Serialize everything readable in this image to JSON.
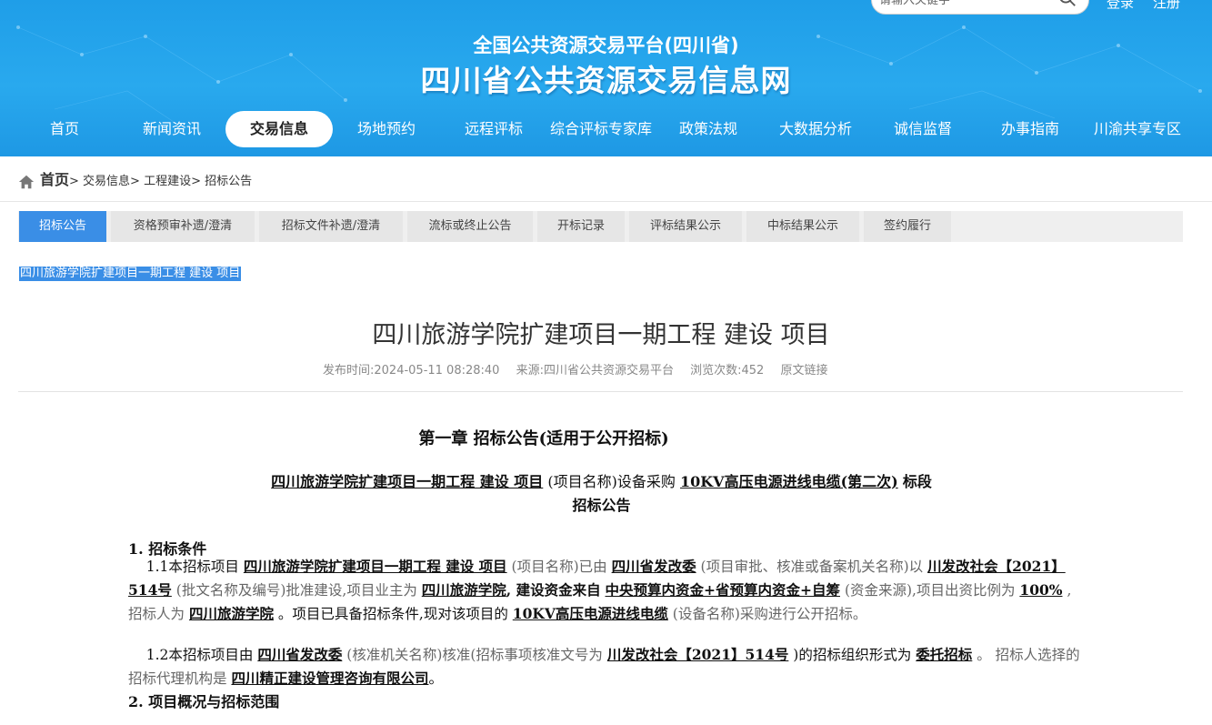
{
  "header": {
    "subtitle": "全国公共资源交易平台(四川省)",
    "title": "四川省公共资源交易信息网",
    "search_placeholder": "请输入关键字",
    "login": "登录",
    "register": "注册",
    "nav": [
      "首页",
      "新闻资讯",
      "交易信息",
      "场地预约",
      "远程评标",
      "综合评标专家库",
      "政策法规",
      "大数据分析",
      "诚信监督",
      "办事指南",
      "川渝共享专区"
    ],
    "active_nav": "交易信息"
  },
  "breadcrumb": {
    "home": "首页",
    "items": [
      "> 交易信息",
      "> 工程建设",
      "> 招标公告"
    ]
  },
  "tabs": [
    "招标公告",
    "资格预审补遗/澄清",
    "招标文件补遗/澄清",
    "流标或终止公告",
    "开标记录",
    "评标结果公示",
    "中标结果公示",
    "签约履行"
  ],
  "selected_text": "四川旅游学院扩建项目一期工程 建设 项目",
  "article": {
    "title": "四川旅游学院扩建项目一期工程 建设 项目",
    "publish_time": "发布时间:2024-05-11 08:28:40",
    "source": "来源:四川省公共资源交易平台",
    "views": "浏览次数:452",
    "original_link": "原文链接"
  },
  "doc": {
    "chapter": "第一章  招标公告(适用于公开招标)",
    "line1": {
      "project": "四川旅游学院扩建项目一期工程  建设  项目",
      "mid": "(项目名称)设备采购",
      "item": "10KV高压电源进线电缆(第二次)",
      "tail": "标段"
    },
    "line2": "招标公告",
    "section1": "1.  招标条件",
    "p1": {
      "a": "1.1本招标项目",
      "b": "四川旅游学院扩建项目一期工程  建设  项目",
      "c": "(项目名称)已由",
      "d": "四川省发改委",
      "e": "(项目审批、核准或备案机关名称)以",
      "f": "川发改社会【2021】514号",
      "g": "(批文名称及编号)批准建设,项目业主为",
      "h": "四川旅游学院",
      "i": ",  建设资金来自",
      "j": "中央预算内资金+省预算内资金+自筹",
      "k": "(资金来源),项目出资比例为",
      "l": "100%",
      "m": ",招标人为",
      "n": "四川旅游学院",
      "o": "。项目已具备招标条件,现对该项目的",
      "p": "10KV高压电源进线电缆",
      "q": "(设备名称)采购进行公开招标。"
    },
    "p2": {
      "a": "1.2本招标项目由",
      "b": "四川省发改委",
      "c": "(核准机关名称)核准(招标事项核准文号为",
      "d": "川发改社会【2021】514号",
      "e": ")的招标组织形式为",
      "f": "委托招标",
      "g": "。  招标人选择的招标代理机构是",
      "h": "四川精正建设管理咨询有限公司",
      "i": "。"
    },
    "section2": "2.  项目概况与招标范围"
  },
  "colors": {
    "header_blue": "#1f9ee8",
    "tab_active": "#3a8ee6"
  }
}
